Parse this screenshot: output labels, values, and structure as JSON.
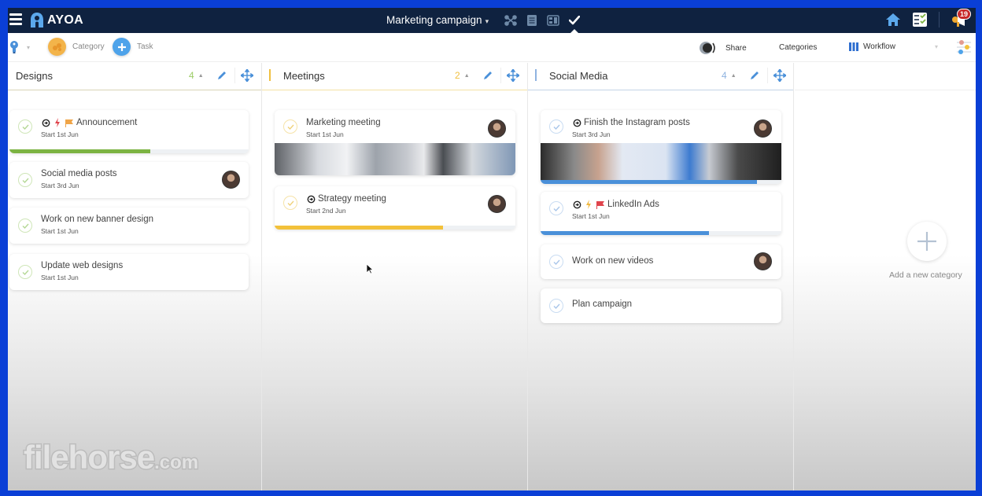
{
  "app": {
    "logo_text": "AYOA",
    "board_title": "Marketing campaign",
    "title_caret": "▾",
    "views": [
      {
        "name": "mind-map-view-icon",
        "active": false
      },
      {
        "name": "document-view-icon",
        "active": false
      },
      {
        "name": "canvas-view-icon",
        "active": false
      },
      {
        "name": "task-view-icon",
        "active": true
      }
    ],
    "notifications_count": "19"
  },
  "toolbar": {
    "category_label": "Category",
    "task_label": "Task",
    "share_label": "Share",
    "categories_label": "Categories",
    "workflow_label": "Workflow",
    "dropdown_caret": "▾"
  },
  "columns": [
    {
      "title": "Designs",
      "count": "4",
      "accent": "#8bc34a",
      "count_color": "#9ccc65",
      "tasks": [
        {
          "title": "Announcement",
          "subtitle": "Start 1st Jun",
          "icons": [
            "recurring",
            "priority-lightning-red",
            "flag-orange"
          ],
          "avatar": false,
          "progress": 0.59,
          "progress_color": "#7cb342",
          "cover": false
        },
        {
          "title": "Social media posts",
          "subtitle": "Start 3rd Jun",
          "icons": [],
          "avatar": true,
          "progress": null,
          "cover": false
        },
        {
          "title": "Work on new banner design",
          "subtitle": "Start 1st Jun",
          "icons": [],
          "avatar": false,
          "progress": null,
          "cover": false
        },
        {
          "title": "Update web designs",
          "subtitle": "Start 1st Jun",
          "icons": [],
          "avatar": false,
          "progress": null,
          "cover": false
        }
      ]
    },
    {
      "title": "Meetings",
      "count": "2",
      "accent": "#f0c040",
      "count_color": "#f0c040",
      "tasks": [
        {
          "title": "Marketing meeting",
          "subtitle": "Start 1st Jun",
          "icons": [],
          "avatar": true,
          "progress": null,
          "cover": true
        },
        {
          "title": "Strategy meeting",
          "subtitle": "Start 2nd Jun",
          "icons": [
            "recurring"
          ],
          "avatar": true,
          "progress": 0.7,
          "progress_color": "#f3c13a",
          "cover": false
        }
      ]
    },
    {
      "title": "Social Media",
      "count": "4",
      "accent": "#8fb3e0",
      "count_color": "#8fb3e0",
      "tasks": [
        {
          "title": "Finish the Instagram posts",
          "subtitle": "Start 3rd Jun",
          "icons": [
            "recurring"
          ],
          "avatar": true,
          "progress": 0.9,
          "progress_color": "#4a90d9",
          "cover": true
        },
        {
          "title": "LinkedIn Ads",
          "subtitle": "Start 1st Jun",
          "icons": [
            "recurring",
            "priority-lightning-orange",
            "flag-red"
          ],
          "avatar": false,
          "progress": 0.7,
          "progress_color": "#4a90d9",
          "cover": false
        },
        {
          "title": "Work on new videos",
          "subtitle": "",
          "icons": [],
          "avatar": true,
          "progress": null,
          "cover": false
        },
        {
          "title": "Plan campaign",
          "subtitle": "",
          "icons": [],
          "avatar": false,
          "progress": null,
          "cover": false
        }
      ]
    }
  ],
  "add_category_label": "Add a new category",
  "watermark": {
    "main": "filehorse",
    "suffix": ".com"
  }
}
